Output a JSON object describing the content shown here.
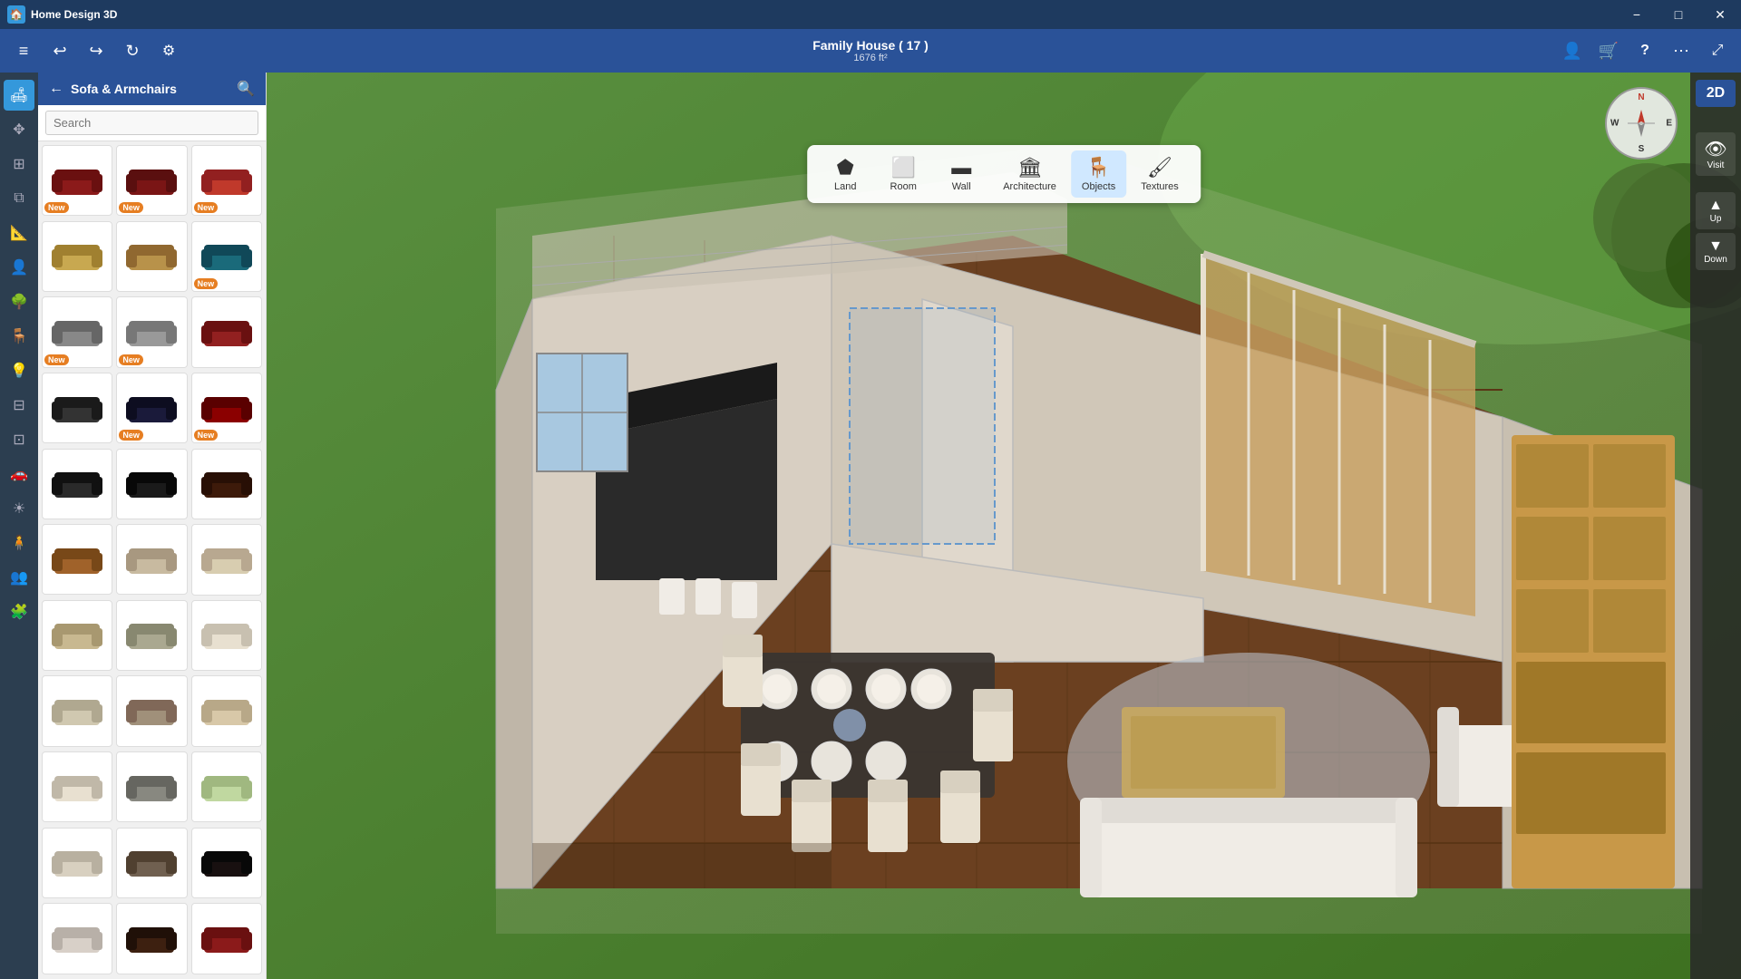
{
  "titleBar": {
    "appName": "Home Design 3D",
    "minimize": "−",
    "maximize": "□",
    "close": "✕"
  },
  "toolbar": {
    "title": "Family House ( 17 )",
    "subtitle": "1676 ft²",
    "undoLabel": "↩",
    "redoLabel": "↪",
    "refreshLabel": "↻",
    "menuLabel": "≡",
    "userIcon": "👤",
    "cartIcon": "🛒",
    "helpIcon": "?",
    "moreIcon": "⋯",
    "expandIcon": "⤢"
  },
  "tools": [
    {
      "id": "land",
      "label": "Land",
      "icon": "▱"
    },
    {
      "id": "room",
      "label": "Room",
      "icon": "⬜"
    },
    {
      "id": "wall",
      "label": "Wall",
      "icon": "▬"
    },
    {
      "id": "architecture",
      "label": "Architecture",
      "icon": "🏠"
    },
    {
      "id": "objects",
      "label": "Objects",
      "icon": "🪑",
      "active": true
    },
    {
      "id": "textures",
      "label": "Textures",
      "icon": "🖌"
    }
  ],
  "sidebar": {
    "category": "Sofa & Armchairs",
    "searchPlaceholder": "Search",
    "icons": [
      {
        "id": "sofa",
        "icon": "🛋",
        "active": true
      },
      {
        "id": "move",
        "icon": "✥"
      },
      {
        "id": "grid",
        "icon": "⊞"
      },
      {
        "id": "layers",
        "icon": "⧉"
      },
      {
        "id": "measure",
        "icon": "📐"
      },
      {
        "id": "person",
        "icon": "👤"
      },
      {
        "id": "tree",
        "icon": "🌳"
      },
      {
        "id": "chair",
        "icon": "🪑"
      },
      {
        "id": "lamp",
        "icon": "💡"
      },
      {
        "id": "stairs",
        "icon": "⊟"
      },
      {
        "id": "fence",
        "icon": "⊡"
      },
      {
        "id": "car",
        "icon": "🚗"
      },
      {
        "id": "sun",
        "icon": "☀"
      },
      {
        "id": "person2",
        "icon": "🧍"
      },
      {
        "id": "group",
        "icon": "👥"
      },
      {
        "id": "puzzle",
        "icon": "🧩"
      }
    ],
    "items": [
      {
        "color": "#8B1a1a",
        "hasNew": true,
        "row": 1,
        "col": 1
      },
      {
        "color": "#7a1515",
        "hasNew": true,
        "row": 1,
        "col": 2
      },
      {
        "color": "#c0392b",
        "hasNew": true,
        "row": 1,
        "col": 3
      },
      {
        "color": "#c8a850",
        "hasNew": false,
        "row": 2,
        "col": 1
      },
      {
        "color": "#b8924a",
        "hasNew": false,
        "row": 2,
        "col": 2
      },
      {
        "color": "#1a6a7a",
        "hasNew": true,
        "row": 2,
        "col": 3
      },
      {
        "color": "#888",
        "hasNew": true,
        "row": 3,
        "col": 1
      },
      {
        "color": "#999",
        "hasNew": true,
        "row": 3,
        "col": 2
      },
      {
        "color": "#922020",
        "hasNew": false,
        "row": 3,
        "col": 3
      },
      {
        "color": "#333",
        "hasNew": false,
        "row": 4,
        "col": 1
      },
      {
        "color": "#1a1a3a",
        "hasNew": false,
        "row": 4,
        "col": 2
      },
      {
        "color": "#8B0000",
        "hasNew": true,
        "row": 4,
        "col": 3
      },
      {
        "color": "#2a2a2a",
        "hasNew": false,
        "row": 5,
        "col": 1
      },
      {
        "color": "#1a1a1a",
        "hasNew": false,
        "row": 5,
        "col": 2
      },
      {
        "color": "#3d1a0a",
        "hasNew": false,
        "row": 5,
        "col": 3
      },
      {
        "color": "#a0622a",
        "hasNew": false,
        "row": 6,
        "col": 1
      },
      {
        "color": "#c8baa0",
        "hasNew": false,
        "row": 6,
        "col": 2
      },
      {
        "color": "#d8cdb0",
        "hasNew": false,
        "row": 6,
        "col": 3
      },
      {
        "color": "#c8b890",
        "hasNew": false,
        "row": 7,
        "col": 1
      },
      {
        "color": "#aaa890",
        "hasNew": false,
        "row": 7,
        "col": 2
      },
      {
        "color": "#e8e0d0",
        "hasNew": false,
        "row": 7,
        "col": 3
      },
      {
        "color": "#d0c8b0",
        "hasNew": false,
        "row": 8,
        "col": 1
      },
      {
        "color": "#a0907a",
        "hasNew": false,
        "row": 8,
        "col": 2
      },
      {
        "color": "#d8c8a8",
        "hasNew": false,
        "row": 8,
        "col": 3
      },
      {
        "color": "#e8e0d0",
        "hasNew": false,
        "row": 9,
        "col": 1
      },
      {
        "color": "#888880",
        "hasNew": false,
        "row": 9,
        "col": 2
      },
      {
        "color": "#c0d8a0",
        "hasNew": false,
        "row": 9,
        "col": 3
      },
      {
        "color": "#d8d0c0",
        "hasNew": false,
        "row": 10,
        "col": 1
      },
      {
        "color": "#706050",
        "hasNew": false,
        "row": 10,
        "col": 2
      },
      {
        "color": "#181010",
        "hasNew": false,
        "row": 10,
        "col": 3
      },
      {
        "color": "#d8d0c8",
        "hasNew": false,
        "row": 11,
        "col": 1
      },
      {
        "color": "#181010",
        "hasNew": false,
        "row": 11,
        "col": 2
      },
      {
        "color": "#8B1a1a",
        "hasNew": false,
        "row": 11,
        "col": 3
      }
    ]
  },
  "compass": {
    "n": "N",
    "s": "S",
    "w": "W",
    "e": "E"
  },
  "viewControls": {
    "view2D": "2D",
    "visitLabel": "Visit",
    "upLabel": "Up",
    "downLabel": "Down"
  },
  "newBadge": "New",
  "colors": {
    "titleBarBg": "#1e3a5f",
    "toolbarBg": "#2a5298",
    "sidebarBg": "#f0f0f0",
    "leftBarBg": "#2c3e50",
    "accentBlue": "#3498db",
    "newBadgeBg": "#e67e22"
  }
}
